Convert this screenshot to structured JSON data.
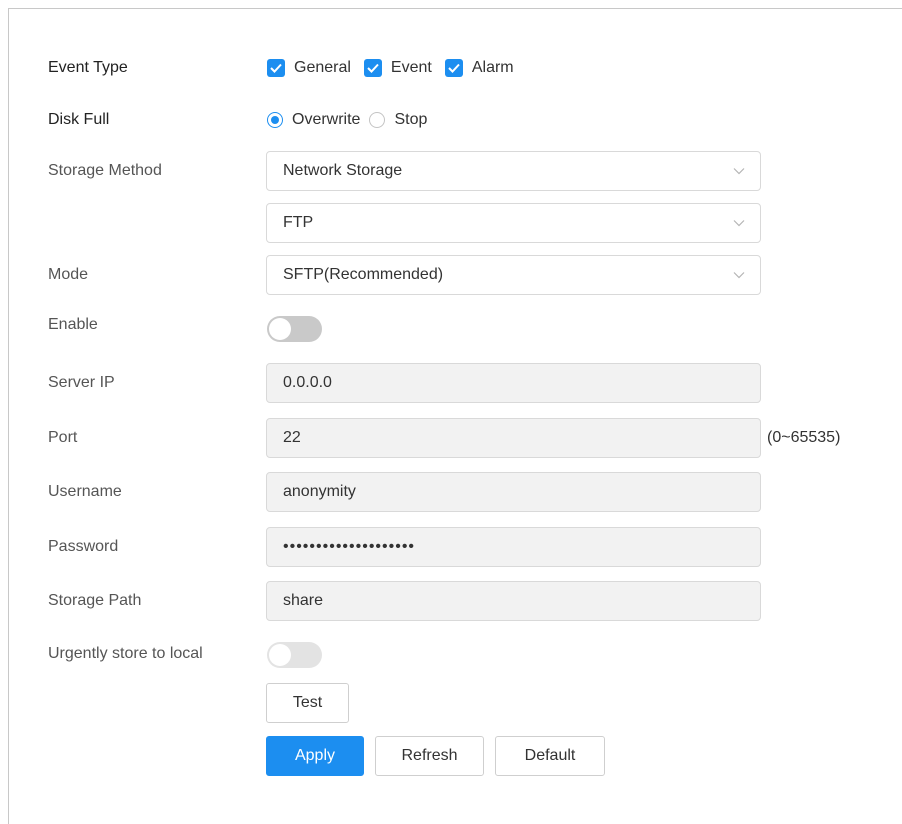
{
  "form": {
    "event_type": {
      "label": "Event Type",
      "options": [
        {
          "label": "General",
          "checked": true
        },
        {
          "label": "Event",
          "checked": true
        },
        {
          "label": "Alarm",
          "checked": true
        }
      ]
    },
    "disk_full": {
      "label": "Disk Full",
      "options": [
        {
          "label": "Overwrite",
          "selected": true
        },
        {
          "label": "Stop",
          "selected": false
        }
      ]
    },
    "storage_method": {
      "label": "Storage Method",
      "value": "Network Storage",
      "sub_value": "FTP"
    },
    "mode": {
      "label": "Mode",
      "value": "SFTP(Recommended)"
    },
    "enable": {
      "label": "Enable",
      "on": false
    },
    "server_ip": {
      "label": "Server IP",
      "value": "0.0.0.0"
    },
    "port": {
      "label": "Port",
      "value": "22",
      "range_hint": "(0~65535)"
    },
    "username": {
      "label": "Username",
      "value": "anonymity"
    },
    "password": {
      "label": "Password",
      "value": "••••••••••••••••••••"
    },
    "storage_path": {
      "label": "Storage Path",
      "value": "share"
    },
    "urgent_local": {
      "label": "Urgently store to local",
      "on": false
    }
  },
  "buttons": {
    "test": "Test",
    "apply": "Apply",
    "refresh": "Refresh",
    "default": "Default"
  },
  "colors": {
    "accent": "#1c8ef0",
    "toggle_off": "#c9c9c9",
    "readonly_bg": "#f2f2f2"
  },
  "icons": {
    "checkbox": "check-icon",
    "dropdown": "chevron-down-icon"
  }
}
